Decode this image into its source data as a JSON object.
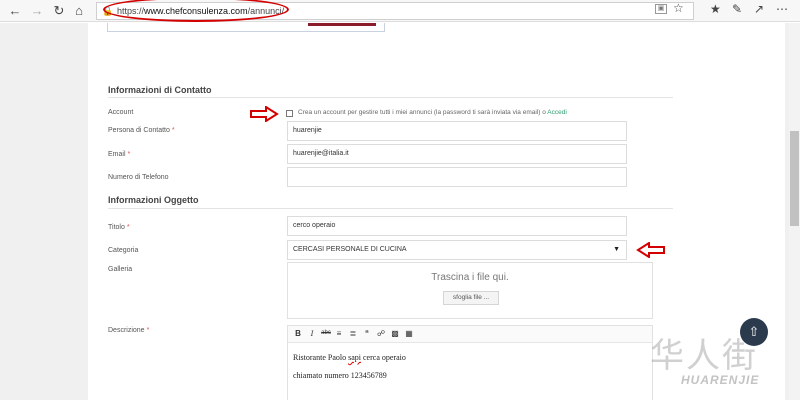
{
  "browser": {
    "url_prefix": "https://",
    "url_host": "www.chefconsulenza.com",
    "url_path": "/annunci/"
  },
  "contact": {
    "section_title": "Informazioni di Contatto",
    "account_label": "Account",
    "account_text": "Crea un account per gestire tutti i miei annunci (la password ti sarà inviata via email) o",
    "accedi_link": "Accedi",
    "person_label": "Persona di Contatto",
    "person_value": "huarenjie",
    "email_label": "Email",
    "email_value": "huarenjie@italia.it",
    "phone_label": "Numero di Telefono",
    "phone_value": ""
  },
  "object": {
    "section_title": "Informazioni Oggetto",
    "title_label": "Titolo",
    "title_value": "cerco operaio",
    "category_label": "Categoria",
    "category_value": "CERCASI PERSONALE DI CUCINA",
    "gallery_label": "Galleria",
    "dropzone_text": "Trascina i file qui.",
    "browse_button": "sfoglia file ...",
    "description_label": "Descrizione",
    "description_line1_a": "Ristorante Paolo ",
    "description_line1_misspelled": "sapi",
    "description_line1_b": "  cerca operaio",
    "description_line2": "chiamato numero 123456789"
  },
  "required_marker": "*",
  "watermark": {
    "chinese": "华人街",
    "latin": "HUARENJIE"
  },
  "colors": {
    "annotation_red": "#d40000",
    "link_green": "#2c9c70",
    "required_red": "#d9534f",
    "rocket_bg": "#2b3a4d"
  }
}
